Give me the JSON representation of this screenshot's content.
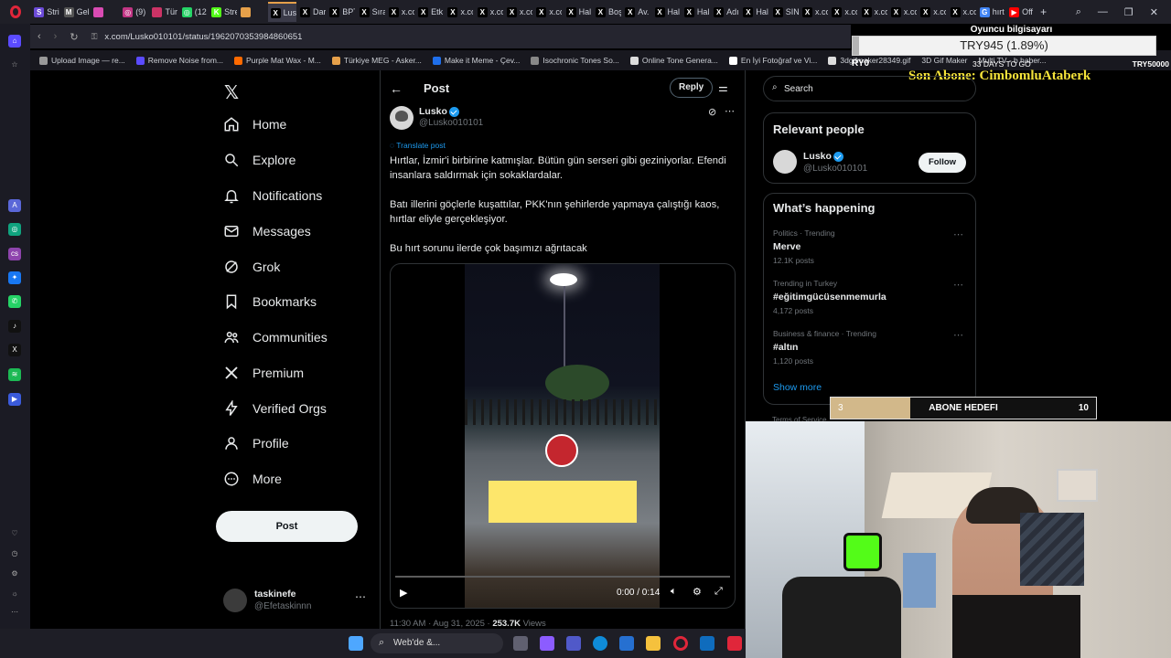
{
  "browser": {
    "tabs": [
      {
        "label": "Stri",
        "color": "#6c4bd8",
        "icon": "S"
      },
      {
        "label": "Gel",
        "color": "#555",
        "icon": "M"
      },
      {
        "label": "",
        "color": "#d94bb3",
        "icon": ""
      },
      {
        "label": "(9)",
        "color": "#c13584",
        "icon": "◎"
      },
      {
        "label": "Tür",
        "color": "#cc3366",
        "icon": ""
      },
      {
        "label": "(12",
        "color": "#25d366",
        "icon": "◎"
      },
      {
        "label": "Stre",
        "color": "#53fc18",
        "icon": "K"
      },
      {
        "label": "",
        "color": "#e6a04a",
        "icon": ""
      },
      {
        "label": "Lusko",
        "color": "#000",
        "icon": "X"
      },
      {
        "label": "Dar",
        "color": "#000",
        "icon": "X"
      },
      {
        "label": "BPT",
        "color": "#000",
        "icon": "X"
      },
      {
        "label": "Sıra",
        "color": "#000",
        "icon": "X"
      },
      {
        "label": "x.co",
        "color": "#000",
        "icon": "X"
      },
      {
        "label": "Etk",
        "color": "#000",
        "icon": "X"
      },
      {
        "label": "x.co",
        "color": "#000",
        "icon": "X"
      },
      {
        "label": "x.co",
        "color": "#000",
        "icon": "X"
      },
      {
        "label": "x.co",
        "color": "#000",
        "icon": "X"
      },
      {
        "label": "x.co",
        "color": "#000",
        "icon": "X"
      },
      {
        "label": "Hal",
        "color": "#000",
        "icon": "X"
      },
      {
        "label": "Boş",
        "color": "#000",
        "icon": "X"
      },
      {
        "label": "Av.",
        "color": "#000",
        "icon": "X"
      },
      {
        "label": "Hal",
        "color": "#000",
        "icon": "X"
      },
      {
        "label": "Hal",
        "color": "#000",
        "icon": "X"
      },
      {
        "label": "Adı",
        "color": "#000",
        "icon": "X"
      },
      {
        "label": "Hal",
        "color": "#000",
        "icon": "X"
      },
      {
        "label": "SIN",
        "color": "#000",
        "icon": "X"
      },
      {
        "label": "x.co",
        "color": "#000",
        "icon": "X"
      },
      {
        "label": "x.co",
        "color": "#000",
        "icon": "X"
      },
      {
        "label": "x.co",
        "color": "#000",
        "icon": "X"
      },
      {
        "label": "x.co",
        "color": "#000",
        "icon": "X"
      },
      {
        "label": "x.co",
        "color": "#000",
        "icon": "X"
      },
      {
        "label": "x.co",
        "color": "#000",
        "icon": "X"
      },
      {
        "label": "hırt",
        "color": "#4285f4",
        "icon": "G"
      },
      {
        "label": "Off",
        "color": "#ff0000",
        "icon": "▶"
      }
    ],
    "url": "x.com/Lusko010101/status/1962070353984860651",
    "bookmarks": [
      "Upload Image — re...",
      "Remove Noise from...",
      "Purple Mat Wax - M...",
      "Türkiye MEG - Asker...",
      "Make it Meme - Çev...",
      "Isochronic Tones So...",
      "Online Tone Genera...",
      "En İyi Fotoğraf ve Vi...",
      "3dgifmaker28349.gif"
    ],
    "bookmarks_extra": [
      "3D Gif Maker",
      "Multi TV - b haber..."
    ]
  },
  "nav": {
    "items": [
      {
        "label": "Home",
        "icon": "home"
      },
      {
        "label": "Explore",
        "icon": "search"
      },
      {
        "label": "Notifications",
        "icon": "bell"
      },
      {
        "label": "Messages",
        "icon": "mail"
      },
      {
        "label": "Grok",
        "icon": "grok"
      },
      {
        "label": "Bookmarks",
        "icon": "bookmark"
      },
      {
        "label": "Communities",
        "icon": "people"
      },
      {
        "label": "Premium",
        "icon": "x"
      },
      {
        "label": "Verified Orgs",
        "icon": "bolt"
      },
      {
        "label": "Profile",
        "icon": "person"
      },
      {
        "label": "More",
        "icon": "more"
      }
    ],
    "post_button": "Post",
    "account": {
      "name": "taskinefe",
      "handle": "@Efetaskinnn"
    }
  },
  "post": {
    "header_title": "Post",
    "reply_button": "Reply",
    "author_name": "Lusko",
    "author_handle": "@Lusko010101",
    "translate": "Translate post",
    "paragraphs": [
      "Hırtlar, İzmir'i birbirine katmışlar. Bütün gün serseri gibi geziniyorlar. Efendi insanlara saldırmak için sokaklardalar.",
      "Batı illerini göçlerle kuşattılar, PKK'nın şehirlerde yapmaya çalıştığı kaos, hırtlar eliyle gerçekleşiyor.",
      "Bu hırt sorunu ilerde çok başımızı ağrıtacak"
    ],
    "video": {
      "time": "0:00 / 0:14",
      "progress": 0.0
    },
    "footer_time": "11:30 AM · Aug 31, 2025 · ",
    "views_count": "253.7K",
    "views_label": " Views"
  },
  "sidebar": {
    "search_placeholder": "Search",
    "relevant_title": "Relevant people",
    "relevant": {
      "name": "Lusko",
      "handle": "@Lusko010101",
      "follow": "Follow"
    },
    "happening_title": "What’s happening",
    "trends": [
      {
        "context": "Politics · Trending",
        "name": "Merve",
        "count": "12.1K posts"
      },
      {
        "context": "Trending in Turkey",
        "name": "#eğitimgücüsenmemurla",
        "count": "4,172 posts"
      },
      {
        "context": "Business & finance · Trending",
        "name": "#altın",
        "count": "1,120 posts"
      }
    ],
    "show_more": "Show more",
    "terms": "Terms of Service"
  },
  "stream": {
    "goal_title": "Oyuncu bilgisayarı",
    "goal_amount": "TRY945 (1.89%)",
    "goal_left": "RY0",
    "goal_days": "33 DAYS TO GO",
    "goal_right": "TRY50000",
    "last_sub": "Son Abone: CimbomluAtaberk",
    "sub_goal_current": "3",
    "sub_goal_label": "ABONE HEDEFI",
    "sub_goal_target": "10",
    "sub_goal_progress": 0.3
  },
  "taskbar": {
    "search": "Web'de &..."
  }
}
